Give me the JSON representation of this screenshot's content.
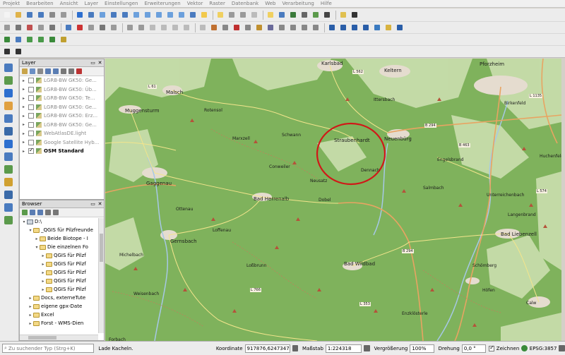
{
  "menu": [
    "Projekt",
    "Bearbeiten",
    "Ansicht",
    "Layer",
    "Einstellungen",
    "Erweiterungen",
    "Vektor",
    "Raster",
    "Datenbank",
    "Web",
    "Verarbeitung",
    "Hilfe"
  ],
  "layers_panel": {
    "title": "Layer",
    "items": [
      {
        "name": "LGRB-BW GK50: Ge...",
        "checked": false,
        "active": false
      },
      {
        "name": "LGRB-BW GK50: Üb...",
        "checked": false,
        "active": false
      },
      {
        "name": "LGRB-BW GK50: Te...",
        "checked": false,
        "active": false
      },
      {
        "name": "LGRB-BW GK50: Ge...",
        "checked": false,
        "active": false
      },
      {
        "name": "LGRB-BW GK50: Erz...",
        "checked": false,
        "active": false
      },
      {
        "name": "LGRB-BW GK50: Ge...",
        "checked": false,
        "active": false
      },
      {
        "name": "WebAtlasDE.light",
        "checked": false,
        "active": false
      },
      {
        "name": "Google Satellite Hyb...",
        "checked": false,
        "active": false
      },
      {
        "name": "OSM Standard",
        "checked": true,
        "active": true
      }
    ]
  },
  "browser_panel": {
    "title": "Browser",
    "items": [
      {
        "label": "D:\\",
        "type": "drive",
        "indent": 1,
        "exp": "▾"
      },
      {
        "label": "_QGIS für Pilzfreunde",
        "type": "folder",
        "indent": 2,
        "exp": "▾"
      },
      {
        "label": "Beide Biotope - I",
        "type": "folder",
        "indent": 3,
        "exp": "▸"
      },
      {
        "label": "Die einzelnen Fo",
        "type": "folder",
        "indent": 3,
        "exp": "▾"
      },
      {
        "label": "QGIS für Pilzf",
        "type": "folder",
        "indent": 4,
        "exp": "▸"
      },
      {
        "label": "QGIS für Pilzf",
        "type": "folder",
        "indent": 4,
        "exp": "▸"
      },
      {
        "label": "QGIS für Pilzf",
        "type": "folder",
        "indent": 4,
        "exp": "▸"
      },
      {
        "label": "QGIS für Pilzf",
        "type": "folder",
        "indent": 4,
        "exp": "▸"
      },
      {
        "label": "QGIS für Pilzf",
        "type": "folder",
        "indent": 4,
        "exp": "▸"
      },
      {
        "label": "Docs, externeTute",
        "type": "folder",
        "indent": 2,
        "exp": "▸"
      },
      {
        "label": "eigene gpx-Date",
        "type": "folder",
        "indent": 2,
        "exp": "▸"
      },
      {
        "label": "Excel",
        "type": "folder",
        "indent": 2,
        "exp": "▸"
      },
      {
        "label": "Forst - WMS-Dien",
        "type": "folder",
        "indent": 2,
        "exp": "▸"
      }
    ]
  },
  "map": {
    "towns": [
      {
        "label": "Karlsbad"
      },
      {
        "label": "Keltern"
      },
      {
        "label": "Pforzheim"
      },
      {
        "label": "Malsch"
      },
      {
        "label": "Muggensturm"
      },
      {
        "label": "Straubenhardt"
      },
      {
        "label": "Neuenbürg"
      },
      {
        "label": "Gaggenau"
      },
      {
        "label": "Bad Herrenalb"
      },
      {
        "label": "Gernsbach"
      },
      {
        "label": "Bad Wildbad"
      },
      {
        "label": "Bad Liebenzell"
      },
      {
        "label": "Dobel"
      },
      {
        "label": "Loffenau"
      },
      {
        "label": "Dennach"
      },
      {
        "label": "Höfen"
      },
      {
        "label": "Calw"
      },
      {
        "label": "Schömberg"
      },
      {
        "label": "Ottenau"
      },
      {
        "label": "Enzklösterle"
      },
      {
        "label": "Ittersbach"
      },
      {
        "label": "Birkenfeld"
      },
      {
        "label": "Engelsbrand"
      },
      {
        "label": "Unterreichenbach"
      },
      {
        "label": "Marxzell"
      },
      {
        "label": "Langenbrand"
      },
      {
        "label": "Weisenbach"
      },
      {
        "label": "Rotensol"
      },
      {
        "label": "Conweiler"
      },
      {
        "label": "Schwann"
      },
      {
        "label": "Neusatz"
      },
      {
        "label": "Michelbach"
      },
      {
        "label": "Loßbrunn"
      },
      {
        "label": "Huchenfeld"
      },
      {
        "label": "Salmbach"
      },
      {
        "label": "Forbach"
      }
    ],
    "road_labels": [
      "B 294",
      "B 463",
      "B 294",
      "L 562",
      "L 1135",
      "L 574",
      "L 353",
      "L 766",
      "L 61"
    ]
  },
  "status": {
    "search_placeholder": "Zu suchender Typ (Strg+K)",
    "message": "Lade Kacheln.",
    "coord_label": "Koordinate",
    "coord_value": "917876,6247347",
    "scale_label": "Maßstab",
    "scale_value": "1:224318",
    "magnifier_label": "Vergrößerung",
    "magnifier_value": "100%",
    "rotation_label": "Drehung",
    "rotation_value": "0,0 °",
    "render_label": "Zeichnen",
    "crs_label": "EPSG:3857"
  },
  "colors": {
    "map_green": "#7fb25c",
    "map_light": "#cfe2b4",
    "road_orange": "#e8a462",
    "river_blue": "#a6c8e6",
    "circle_red": "#d01818"
  }
}
